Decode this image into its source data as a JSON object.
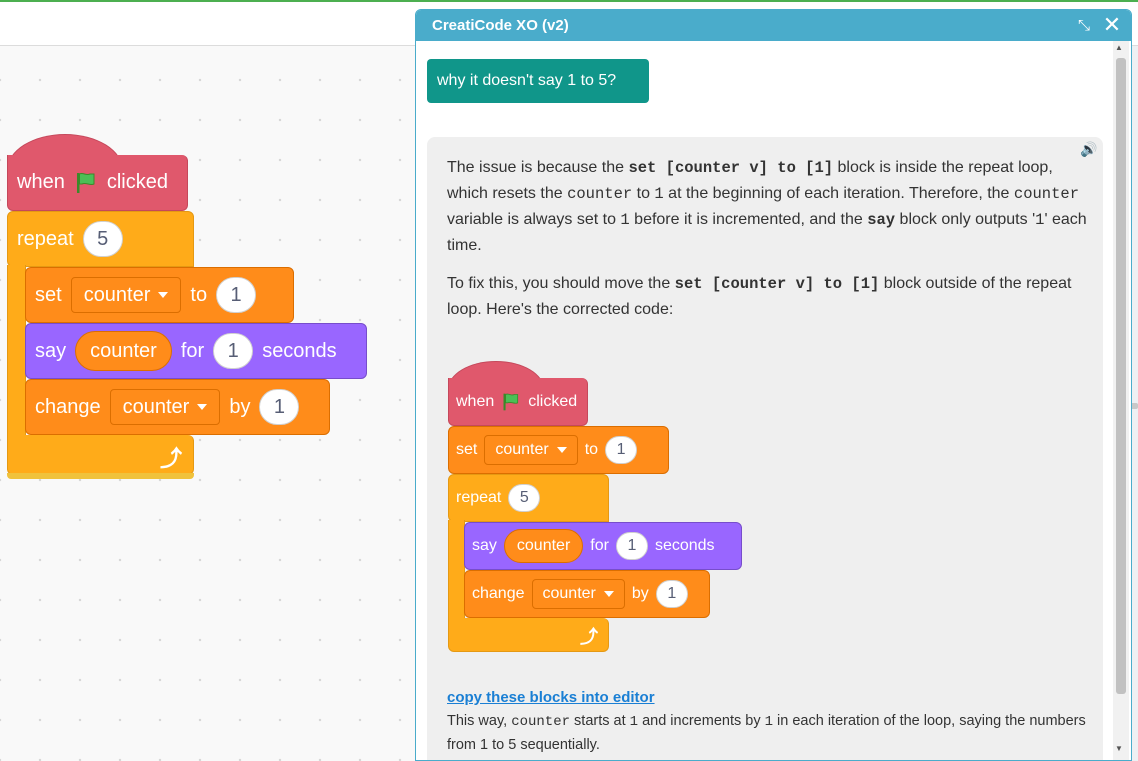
{
  "workspace_script": {
    "hat": {
      "when": "when",
      "clicked": "clicked"
    },
    "repeat": {
      "label": "repeat",
      "count": "5"
    },
    "set": {
      "label": "set",
      "variable": "counter",
      "to": "to",
      "value": "1"
    },
    "say": {
      "label": "say",
      "reporter": "counter",
      "for": "for",
      "value": "1",
      "seconds": "seconds"
    },
    "change": {
      "label": "change",
      "variable": "counter",
      "by": "by",
      "value": "1"
    }
  },
  "dialog": {
    "title": "CreatiCode XO (v2)",
    "minimize_icon": "minimize-arrows-icon",
    "close_icon": "close-icon",
    "user_message": "why it doesn't say 1 to 5?",
    "assistant": {
      "p1": {
        "a": "The issue is because the ",
        "code1": "set [counter v] to [1]",
        "b": " block is inside the repeat loop, which resets the ",
        "code2": "counter",
        "c": " to ",
        "code3": "1",
        "d": " at the beginning of each iteration. Therefore, the ",
        "code4": "counter",
        "e": " variable is always set to ",
        "code5": "1",
        "f": " before it is incremented, and the ",
        "code6": "say",
        "g": " block only outputs '",
        "code7": "1",
        "h": "' each time."
      },
      "p2": {
        "a": "To fix this, you should move the ",
        "code1": "set [counter v] to [1]",
        "b": " block outside of the repeat loop. Here's the corrected code:"
      },
      "corrected_script": {
        "hat": {
          "when": "when",
          "clicked": "clicked"
        },
        "set": {
          "label": "set",
          "variable": "counter",
          "to": "to",
          "value": "1"
        },
        "repeat": {
          "label": "repeat",
          "count": "5"
        },
        "say": {
          "label": "say",
          "reporter": "counter",
          "for": "for",
          "value": "1",
          "seconds": "seconds"
        },
        "change": {
          "label": "change",
          "variable": "counter",
          "by": "by",
          "value": "1"
        }
      },
      "copy_link": "copy these blocks into editor",
      "closing": {
        "a": "This way, ",
        "code1": "counter",
        "b": " starts at ",
        "code2": "1",
        "c": " and increments by ",
        "code3": "1",
        "d": " in each iteration of the loop, saying the numbers from 1 to 5 sequentially."
      }
    }
  },
  "colors": {
    "events": "#e0586c",
    "control": "#ffab19",
    "variables": "#ff8c1a",
    "looks": "#9966ff",
    "dialog_header": "#4aaccb",
    "user_bubble": "#10968a",
    "link": "#1a7fd4"
  }
}
